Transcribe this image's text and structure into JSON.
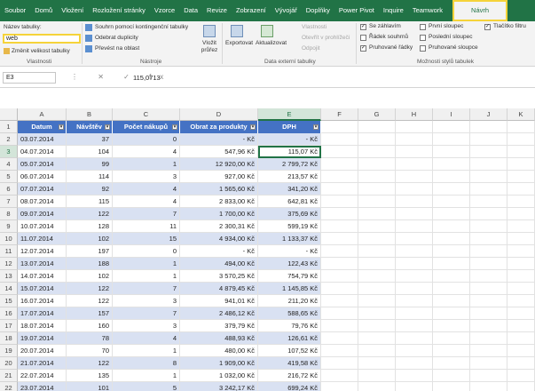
{
  "tabs": [
    "Soubor",
    "Domů",
    "Vložení",
    "Rozložení stránky",
    "Vzorce",
    "Data",
    "Revize",
    "Zobrazení",
    "Vývojář",
    "Doplňky",
    "Power Pivot",
    "Inquire",
    "Teamwork",
    "Návrh"
  ],
  "ribbon": {
    "name_label": "Název tabulky:",
    "name_value": "web",
    "resize": "Změnit velikost tabulky",
    "g_vlastnosti": "Vlastnosti",
    "summarize": "Souhrn pomocí kontingenční tabulky",
    "remove_dup": "Odebrat duplicity",
    "convert": "Převést na oblast",
    "slicer": "Vložit průřez",
    "g_nastroje": "Nástroje",
    "export": "Exportovat",
    "refresh": "Aktualizovat",
    "props": "Vlastnosti",
    "open_browser": "Otevřít v prohlížeči",
    "unlink": "Odpojit",
    "g_external": "Data externí tabulky",
    "header_row": "Se záhlavím",
    "total_row": "Řádek souhrnů",
    "banded_rows": "Pruhované řádky",
    "first_col": "První sloupec",
    "last_col": "Poslední sloupec",
    "banded_cols": "Pruhované sloupce",
    "filter_btn": "Tlačítko filtru",
    "g_styles": "Možnosti stylů tabulek"
  },
  "formula": {
    "cellref": "E3",
    "icons": "⋮ ✕ ✓ fx",
    "value": "115,0713"
  },
  "columns": [
    "A",
    "B",
    "C",
    "D",
    "E",
    "F",
    "G",
    "H",
    "I",
    "J",
    "K"
  ],
  "table_headers": [
    "Datum",
    "Návštěv",
    "Počet nákupů",
    "Obrat za produkty",
    "DPH"
  ],
  "rows": [
    [
      "03.07.2014",
      "37",
      "0",
      "-   Kč",
      "-   Kč"
    ],
    [
      "04.07.2014",
      "104",
      "4",
      "547,96 Kč",
      "115,07 Kč"
    ],
    [
      "05.07.2014",
      "99",
      "1",
      "12 920,00 Kč",
      "2 799,72 Kč"
    ],
    [
      "06.07.2014",
      "114",
      "3",
      "927,00 Kč",
      "213,57 Kč"
    ],
    [
      "07.07.2014",
      "92",
      "4",
      "1 565,60 Kč",
      "341,20 Kč"
    ],
    [
      "08.07.2014",
      "115",
      "4",
      "2 833,00 Kč",
      "642,81 Kč"
    ],
    [
      "09.07.2014",
      "122",
      "7",
      "1 700,00 Kč",
      "375,69 Kč"
    ],
    [
      "10.07.2014",
      "128",
      "11",
      "2 300,31 Kč",
      "599,19 Kč"
    ],
    [
      "11.07.2014",
      "102",
      "15",
      "4 934,00 Kč",
      "1 133,37 Kč"
    ],
    [
      "12.07.2014",
      "197",
      "0",
      "-   Kč",
      "-   Kč"
    ],
    [
      "13.07.2014",
      "188",
      "1",
      "494,00 Kč",
      "122,43 Kč"
    ],
    [
      "14.07.2014",
      "102",
      "1",
      "3 570,25 Kč",
      "754,79 Kč"
    ],
    [
      "15.07.2014",
      "122",
      "7",
      "4 879,45 Kč",
      "1 145,85 Kč"
    ],
    [
      "16.07.2014",
      "122",
      "3",
      "941,01 Kč",
      "211,20 Kč"
    ],
    [
      "17.07.2014",
      "157",
      "7",
      "2 486,12 Kč",
      "588,65 Kč"
    ],
    [
      "18.07.2014",
      "160",
      "3",
      "379,79 Kč",
      "79,76 Kč"
    ],
    [
      "19.07.2014",
      "78",
      "4",
      "488,93 Kč",
      "126,61 Kč"
    ],
    [
      "20.07.2014",
      "70",
      "1",
      "480,00 Kč",
      "107,52 Kč"
    ],
    [
      "21.07.2014",
      "122",
      "8",
      "1 909,00 Kč",
      "419,58 Kč"
    ],
    [
      "22.07.2014",
      "135",
      "1",
      "1 032,00 Kč",
      "216,72 Kč"
    ],
    [
      "23.07.2014",
      "101",
      "5",
      "3 242,17 Kč",
      "699,24 Kč"
    ],
    [
      "24.07.2014",
      "106",
      "4",
      "673,78 Kč",
      "213,31 Kč"
    ]
  ],
  "colors": {
    "excel_green": "#217346",
    "table_header": "#4472c4",
    "band": "#d9e1f2",
    "highlight": "#f5d33a"
  }
}
